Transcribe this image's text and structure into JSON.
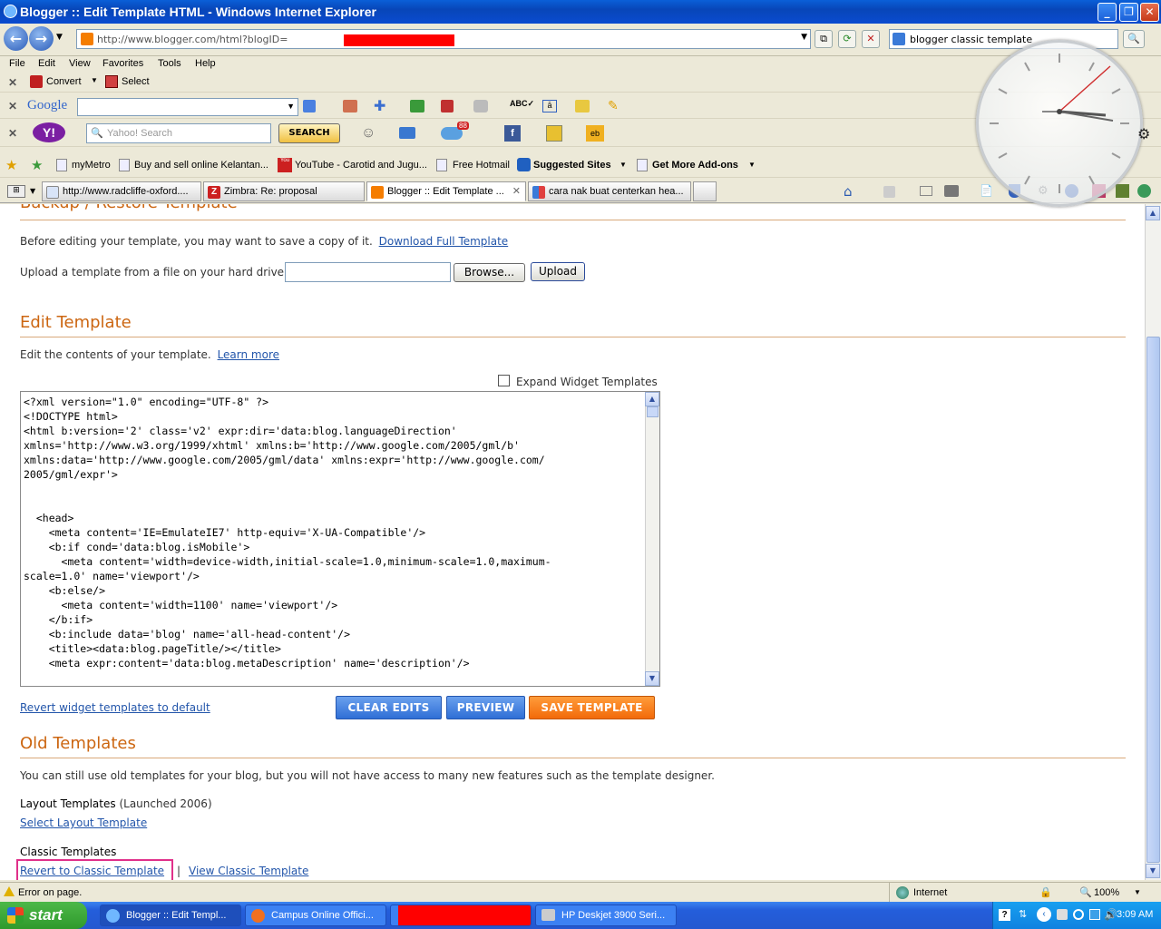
{
  "window": {
    "title": "Blogger :: Edit Template HTML - Windows Internet Explorer"
  },
  "address": {
    "url": "http://www.blogger.com/html?blogID=",
    "search_value": "blogger classic template"
  },
  "menu": [
    "File",
    "Edit",
    "View",
    "Favorites",
    "Tools",
    "Help"
  ],
  "toolbar1": {
    "convert": "Convert",
    "select": "Select"
  },
  "google_toolbar": {
    "logo": "Google"
  },
  "yahoo_toolbar": {
    "logo": "Y!",
    "search_placeholder": "Yahoo! Search",
    "search_button": "SEARCH",
    "badge": "88"
  },
  "favorites": [
    "myMetro",
    "Buy and sell online Kelantan...",
    "YouTube - Carotid and Jugu...",
    "Free Hotmail",
    "Suggested Sites",
    "Get More Add-ons"
  ],
  "tabs": [
    {
      "label": "http://www.radcliffe-oxford...."
    },
    {
      "label": "Zimbra: Re: proposal"
    },
    {
      "label": "Blogger :: Edit Template ..."
    },
    {
      "label": "cara nak buat centerkan hea..."
    }
  ],
  "page": {
    "backup_heading": "Backup / Restore Template",
    "backup_text": "Before editing your template, you may want to save a copy of it.",
    "download_link": "Download Full Template",
    "upload_text": "Upload a template from a file on your hard drive:",
    "browse_label": "Browse...",
    "upload_label": "Upload",
    "edit_heading": "Edit Template",
    "edit_text": "Edit the contents of your template.",
    "learn_more": "Learn more",
    "expand_widgets": "Expand Widget Templates",
    "code": "<?xml version=\"1.0\" encoding=\"UTF-8\" ?>\n<!DOCTYPE html>\n<html b:version='2' class='v2' expr:dir='data:blog.languageDirection'\nxmlns='http://www.w3.org/1999/xhtml' xmlns:b='http://www.google.com/2005/gml/b'\nxmlns:data='http://www.google.com/2005/gml/data' xmlns:expr='http://www.google.com/\n2005/gml/expr'>\n\n\n  <head>\n    <meta content='IE=EmulateIE7' http-equiv='X-UA-Compatible'/>\n    <b:if cond='data:blog.isMobile'>\n      <meta content='width=device-width,initial-scale=1.0,minimum-scale=1.0,maximum-\nscale=1.0' name='viewport'/>\n    <b:else/>\n      <meta content='width=1100' name='viewport'/>\n    </b:if>\n    <b:include data='blog' name='all-head-content'/>\n    <title><data:blog.pageTitle/></title>\n    <meta expr:content='data:blog.metaDescription' name='description'/>",
    "revert_widget": "Revert widget templates to default",
    "clear_edits": "CLEAR EDITS",
    "preview": "PREVIEW",
    "save_template": "SAVE TEMPLATE",
    "old_heading": "Old Templates",
    "old_text": "You can still use old templates for your blog, but you will not have access to many new features such as the template designer.",
    "layout_label": "Layout Templates",
    "layout_launched": "(Launched 2006)",
    "select_layout": "Select Layout Template",
    "classic_label": "Classic Templates",
    "revert_classic": "Revert to Classic Template",
    "separator": "|",
    "view_classic": "View Classic Template"
  },
  "status": {
    "text": "Error on page.",
    "zone": "Internet",
    "zoom": "100%"
  },
  "taskbar": {
    "start": "start",
    "tasks": [
      "Blogger :: Edit Templ...",
      "Campus Online Offici...",
      "HP Deskjet 3900 Seri..."
    ],
    "time": "3:09 AM"
  },
  "colors": {
    "heading": "#cc6611",
    "link": "#2255aa",
    "save": "#f26a0a",
    "button_blue": "#2f6fd6",
    "highlight": "#e0308a"
  }
}
